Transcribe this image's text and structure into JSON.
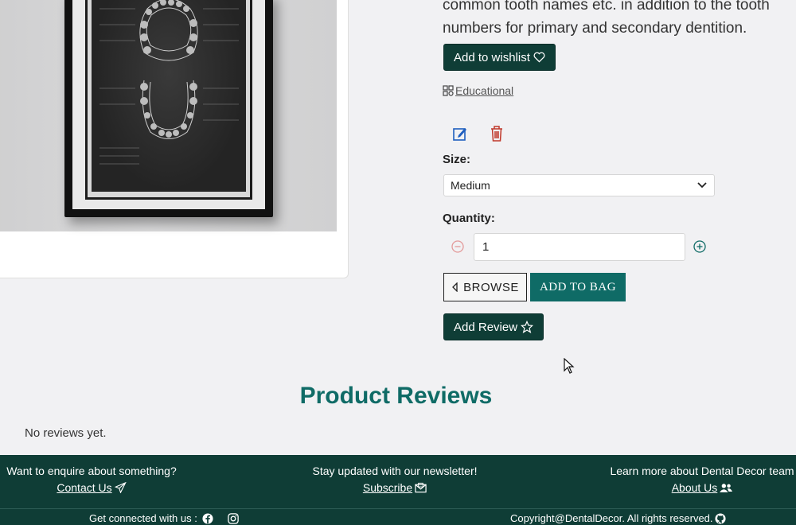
{
  "product": {
    "description_line1": "common tooth names etc. in addition to the tooth",
    "description_line2": "numbers for primary and secondary dentition.",
    "wishlist_label": "Add to wishlist",
    "category_label": "Educational",
    "size_label": "Size:",
    "size_value": "Medium",
    "quantity_label": "Quantity:",
    "quantity_value": "1",
    "browse_label": "BROWSE",
    "add_to_bag_label": "ADD TO BAG",
    "add_review_label": "Add Review"
  },
  "reviews": {
    "title": "Product Reviews",
    "empty_text": "No reviews yet."
  },
  "footer": {
    "col1_heading": "Want to enquire about something?",
    "col1_link": "Contact Us",
    "col2_heading": "Stay updated with our newsletter!",
    "col2_link": "Subscribe",
    "col3_heading": "Learn more about Dental Decor team",
    "col3_link": "About Us",
    "connect_label": "Get connected with us :",
    "copyright": "Copyright@DentalDecor. All rights reserved."
  },
  "colors": {
    "dark_green": "#0f3d36",
    "teal": "#0f6b66"
  },
  "icons": [
    "heart-icon",
    "category-grid-icon",
    "edit-icon",
    "trash-icon",
    "chevron-down-icon",
    "minus-circle-icon",
    "plus-circle-icon",
    "caret-left-icon",
    "star-icon",
    "paper-plane-icon",
    "envelope-icon",
    "users-icon",
    "facebook-icon",
    "instagram-icon",
    "github-icon",
    "mouse-cursor-icon"
  ]
}
